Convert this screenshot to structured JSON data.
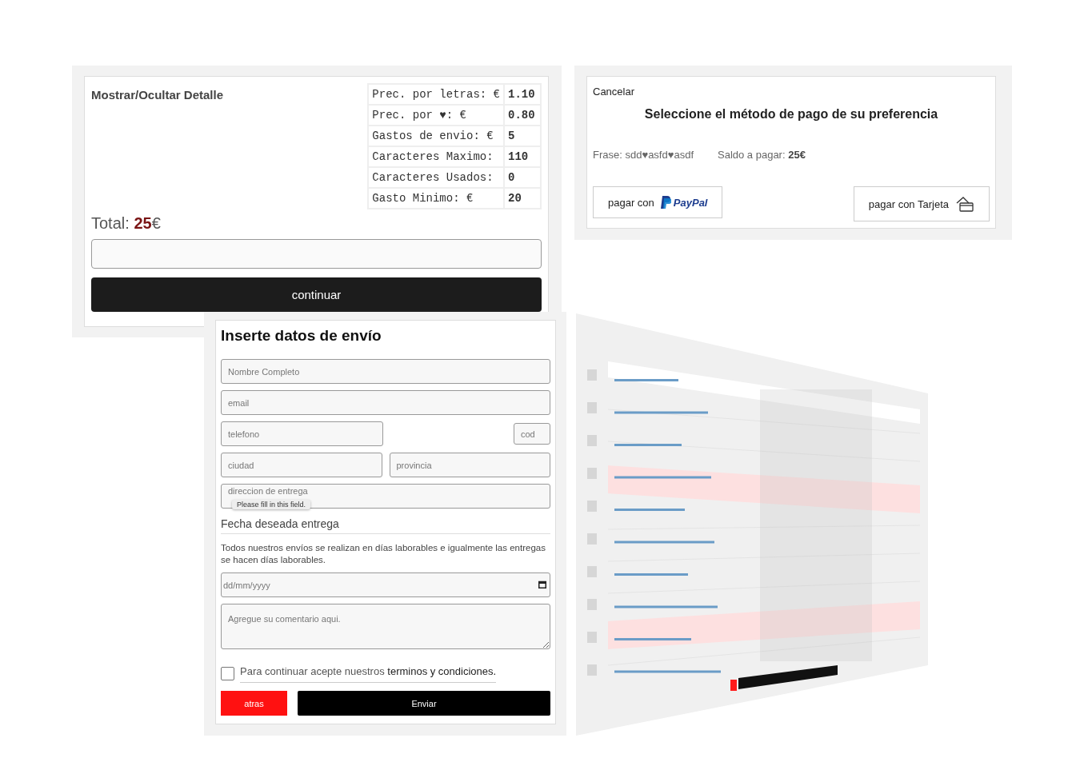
{
  "summary": {
    "toggle": "Mostrar/Ocultar Detalle",
    "details": [
      {
        "label": "Prec. por letras: €",
        "value": "1.10"
      },
      {
        "label": "Prec. por ♥: €",
        "value": "0.80"
      },
      {
        "label": "Gastos de envio: €",
        "value": "5"
      },
      {
        "label": "Caracteres Maximo:",
        "value": "110"
      },
      {
        "label": "Caracteres Usados:",
        "value": "0"
      },
      {
        "label": "Gasto Minimo: €",
        "value": "20"
      }
    ],
    "total_label": "Total:",
    "total_amount": "25",
    "currency": "€",
    "continue_button": "continuar"
  },
  "payment": {
    "cancel": "Cancelar",
    "title": "Seleccione el método de pago de su preferencia",
    "phrase": "Frase: sdd♥asfd♥asdf",
    "balance": "Saldo a pagar: **25€**",
    "buttons": [
      {
        "kind": "paypal",
        "label": "pagar con",
        "logo": "PayPal"
      },
      {
        "kind": "card",
        "label": "pagar con Tarjeta"
      }
    ]
  },
  "shipping": {
    "title": "Inserte datos de envío",
    "name": {
      "placeholder": "Nombre Completo"
    },
    "email": {
      "placeholder": "email"
    },
    "phone": {
      "placeholder": "telefono"
    },
    "code": {
      "placeholder": "cod"
    },
    "city": {
      "placeholder": "ciudad"
    },
    "province": {
      "placeholder": "provincia"
    },
    "address": {
      "placeholder": "direccion de entrega"
    },
    "tooltip": "Please fill in this field.",
    "date_heading": "Fecha deseada entrega",
    "note": "Todos nuestros envíos se realizan en días laborables e igualmente las entregas se hacen días laborables.",
    "date": {
      "placeholder": "dd/mm/yyyy"
    },
    "comment": {
      "placeholder": "Agregue su comentario aqui."
    },
    "terms": {
      "checked": false,
      "text": "Para continuar acepte nuestros",
      "link": "terminos y condiciones."
    },
    "back_button": "atras",
    "submit_button": "Enviar"
  }
}
